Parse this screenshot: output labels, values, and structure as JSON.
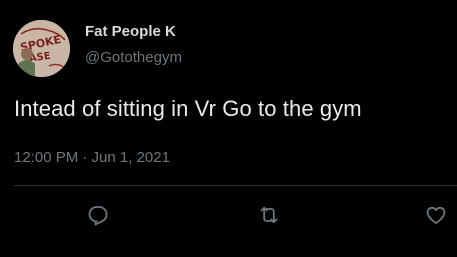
{
  "tweet": {
    "author": {
      "display_name": "Fat People K",
      "handle": "@Gotothegym",
      "avatar_text": "SPOKE ASE"
    },
    "text": "Intead of sitting in Vr Go to the gym",
    "timestamp": "12:00 PM · Jun 1, 2021"
  },
  "actions": [
    {
      "name": "reply",
      "icon": "reply-icon"
    },
    {
      "name": "retweet",
      "icon": "retweet-icon"
    },
    {
      "name": "like",
      "icon": "heart-icon"
    }
  ],
  "colors": {
    "background": "#000000",
    "text_primary": "#e7e9ea",
    "text_secondary": "#6e767d",
    "divider": "#2f3336",
    "icon": "#6e767d"
  }
}
